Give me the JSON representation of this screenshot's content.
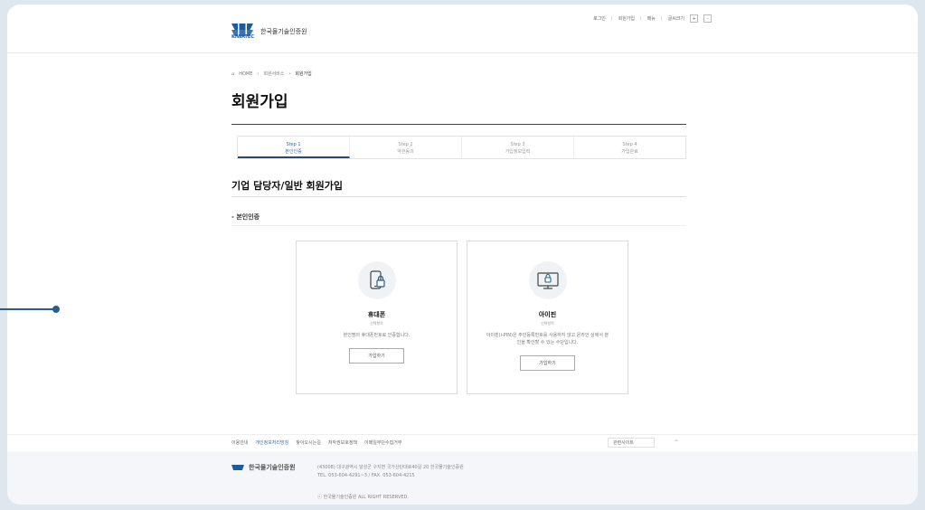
{
  "header": {
    "logo_en": "KIWATEC",
    "logo_kr": "한국물기술인증원",
    "util_links": [
      "로그인",
      "회원가입",
      "메뉴",
      "글씨크기"
    ],
    "zoom_plus": "+",
    "zoom_minus": "-"
  },
  "breadcrumb": [
    "HOME",
    "회원서비스",
    "회원가입"
  ],
  "page_title": "회원가입",
  "steps": [
    {
      "step": "Step 1",
      "label": "본인인증",
      "active": true
    },
    {
      "step": "Step 2",
      "label": "약관동의",
      "active": false
    },
    {
      "step": "Step 3",
      "label": "가입정보입력",
      "active": false
    },
    {
      "step": "Step 4",
      "label": "가입완료",
      "active": false
    }
  ],
  "section_title": "기업 담당자/일반 회원가입",
  "sub_title": "본인인증",
  "cards": [
    {
      "title": "휴대폰",
      "sub": "선택항목",
      "desc": "본인명의 휴대폰번호로 인증합니다.",
      "button": "가입하기"
    },
    {
      "title": "아이핀",
      "sub": "선택항목",
      "desc": "아이핀(i-PIN)은 주민등록번호를 사용하지 않고 온라인 상에서 본인을 확인할 수 있는 수단입니다.",
      "button": "가입하기"
    }
  ],
  "footer": {
    "links": [
      "이용안내",
      "개인정보처리방침",
      "찾아오시는길",
      "저작권보호정책",
      "이메일무단수집거부"
    ],
    "family_site": "관련사이트",
    "top": "^",
    "logo_text": "한국물기술인증원",
    "address": "(43008) 대구광역시 달성군 구지면 국가산단대로40길 20 한국물기술인증원",
    "tel": "TEL. 053-604-4291~3 / FAX. 053-604-4215",
    "copyright": "ⓒ 한국물기술인증원 ALL RIGHT RESERVED."
  },
  "colors": {
    "accent": "#2a4a6b",
    "link": "#3a6ea5",
    "bg": "#dfe7ee"
  }
}
